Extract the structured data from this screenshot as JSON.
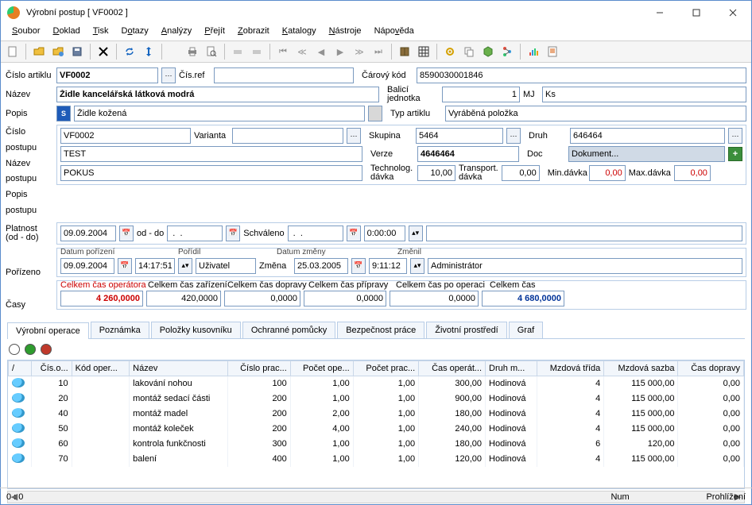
{
  "window": {
    "title": "Výrobní postup [ VF0002 ]"
  },
  "menu": [
    "Soubor",
    "Doklad",
    "Tisk",
    "Dotazy",
    "Analýzy",
    "Přejít",
    "Zobrazit",
    "Katalogy",
    "Nástroje",
    "Nápověda"
  ],
  "header": {
    "cislo_artiklu_lbl": "Číslo artiklu",
    "cislo_artiklu": "VF0002",
    "cis_ref_lbl": "Čís.ref",
    "cis_ref": "",
    "carovy_kod_lbl": "Čárový kód",
    "carovy_kod": "8590030001846",
    "nazev_lbl": "Název",
    "nazev": "Židle kancelářská látková modrá",
    "balici_lbl": "Balicí jednotka",
    "balici": "1",
    "mj_lbl": "MJ",
    "mj": "Ks",
    "popis_lbl": "Popis",
    "popis": "Židle kožená",
    "typ_artiklu_lbl": "Typ artiklu",
    "typ_artiklu": "Vyráběná položka"
  },
  "postup": {
    "cislo_postupu_lbl": "Číslo postupu",
    "cislo": "VF0002",
    "varianta_lbl": "Varianta",
    "varianta": "",
    "skupina_lbl": "Skupina",
    "skupina": "5464",
    "druh_lbl": "Druh",
    "druh": "646464",
    "nazev_postupu_lbl": "Název postupu",
    "nazev": "TEST",
    "verze_lbl": "Verze",
    "verze": "4646464",
    "doc_lbl": "Doc",
    "doc": "Dokument...",
    "popis_postupu_lbl": "Popis postupu",
    "popis": "POKUS",
    "technolog_lbl": "Technolog. dávka",
    "technolog": "10,00",
    "transport_lbl": "Transport. dávka",
    "transport": "0,00",
    "min_davka_lbl": "Min.dávka",
    "min_davka": "0,00",
    "max_davka_lbl": "Max.dávka",
    "max_davka": "0,00"
  },
  "platnost": {
    "lbl": "Platnost (od - do)",
    "od": "09.09.2004",
    "oddo": "od - do",
    "do": " .  .    ",
    "schvaleno_lbl": "Schváleno",
    "schvaleno": " .  .    ",
    "cas": "0:00:00"
  },
  "porizeno": {
    "lbl": "Pořízeno",
    "datum_por_lbl": "Datum pořízení",
    "datum_por": "09.09.2004",
    "cas_por": "14:17:51",
    "poridil_lbl": "Pořídil",
    "poridil": "Uživatel",
    "zmena_lbl": "Změna",
    "datum_zm_lbl": "Datum změny",
    "datum_zm": "25.03.2005",
    "cas_zm": "9:11:12",
    "zmenil_lbl": "Změnil",
    "zmenil": "Administrátor"
  },
  "casy": {
    "lbl": "Časy",
    "h_operator": "Celkem čas operátora",
    "v_operator": "4 260,0000",
    "h_zarizeni": "Celkem čas zařízení",
    "v_zarizeni": "420,0000",
    "h_dopravy": "Celkem čas dopravy",
    "v_dopravy": "0,0000",
    "h_pripravy": "Celkem čas přípravy",
    "v_pripravy": "0,0000",
    "h_pooperaci": "Celkem čas po operaci",
    "v_pooperaci": "0,0000",
    "h_celkem": "Celkem čas",
    "v_celkem": "4 680,0000"
  },
  "tabs": [
    "Výrobní operace",
    "Poznámka",
    "Položky kusovníku",
    "Ochranné pomůcky",
    "Bezpečnost práce",
    "Životní prostředí",
    "Graf"
  ],
  "grid": {
    "cols": [
      "/",
      "Čís.o...",
      "Kód oper...",
      "Název",
      "Číslo prac...",
      "Počet ope...",
      "Počet prac...",
      "Čas operát...",
      "Druh m...",
      "Mzdová třída",
      "Mzdová sazba",
      "Čas dopravy"
    ],
    "rows": [
      {
        "cis": "10",
        "kod": "",
        "nazev": "lakování nohou",
        "cprac": "100",
        "pope": "1,00",
        "pprac": "1,00",
        "cas": "300,00",
        "druh": "Hodinová",
        "trida": "4",
        "sazba": "115 000,00",
        "dopr": "0,00"
      },
      {
        "cis": "20",
        "kod": "",
        "nazev": "montáž sedací části",
        "cprac": "200",
        "pope": "1,00",
        "pprac": "1,00",
        "cas": "900,00",
        "druh": "Hodinová",
        "trida": "4",
        "sazba": "115 000,00",
        "dopr": "0,00"
      },
      {
        "cis": "40",
        "kod": "",
        "nazev": "montáž madel",
        "cprac": "200",
        "pope": "2,00",
        "pprac": "1,00",
        "cas": "180,00",
        "druh": "Hodinová",
        "trida": "4",
        "sazba": "115 000,00",
        "dopr": "0,00"
      },
      {
        "cis": "50",
        "kod": "",
        "nazev": "montáž koleček",
        "cprac": "200",
        "pope": "4,00",
        "pprac": "1,00",
        "cas": "240,00",
        "druh": "Hodinová",
        "trida": "4",
        "sazba": "115 000,00",
        "dopr": "0,00"
      },
      {
        "cis": "60",
        "kod": "",
        "nazev": "kontrola funkčnosti",
        "cprac": "300",
        "pope": "1,00",
        "pprac": "1,00",
        "cas": "180,00",
        "druh": "Hodinová",
        "trida": "6",
        "sazba": "120,00",
        "dopr": "0,00"
      },
      {
        "cis": "70",
        "kod": "",
        "nazev": "balení",
        "cprac": "400",
        "pope": "1,00",
        "pprac": "1,00",
        "cas": "120,00",
        "druh": "Hodinová",
        "trida": "4",
        "sazba": "115 000,00",
        "dopr": "0,00"
      }
    ]
  },
  "status": {
    "left": "0 :   0",
    "num": "Num",
    "mode": "Prohlížení"
  }
}
